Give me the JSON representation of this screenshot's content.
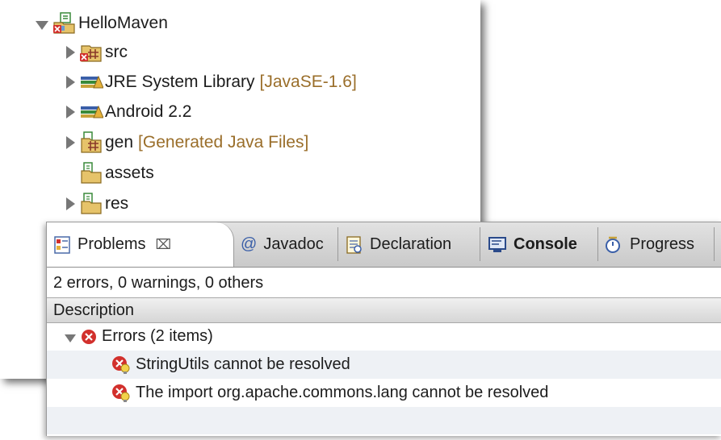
{
  "project_tree": {
    "root": {
      "label": "HelloMaven",
      "expanded": true,
      "icon": "maven-project-error-icon"
    },
    "items": [
      {
        "label": "src",
        "decoration": "",
        "expandable": true,
        "icon": "source-folder-error-icon"
      },
      {
        "label": "JRE System Library",
        "decoration": "[JavaSE-1.6]",
        "expandable": true,
        "icon": "library-icon"
      },
      {
        "label": "Android 2.2",
        "decoration": "",
        "expandable": true,
        "icon": "library-icon"
      },
      {
        "label": "gen",
        "decoration": "[Generated Java Files]",
        "expandable": true,
        "icon": "source-folder-icon"
      },
      {
        "label": "assets",
        "decoration": "",
        "expandable": false,
        "icon": "folder-icon"
      },
      {
        "label": "res",
        "decoration": "",
        "expandable": true,
        "icon": "folder-icon"
      }
    ]
  },
  "problems_view": {
    "tabs": [
      {
        "label": "Problems",
        "active": true,
        "close": "⌧",
        "icon": "problems-icon"
      },
      {
        "label": "Javadoc",
        "active": false,
        "icon": "at-icon",
        "icon_text": "@"
      },
      {
        "label": "Declaration",
        "active": false,
        "icon": "declaration-icon"
      },
      {
        "label": "Console",
        "active": false,
        "icon": "console-icon"
      },
      {
        "label": "Progress",
        "active": false,
        "icon": "progress-icon"
      }
    ],
    "summary": "2 errors, 0 warnings, 0 others",
    "column_header": "Description",
    "group": {
      "label": "Errors (2 items)",
      "expanded": true,
      "icon": "error-icon"
    },
    "errors": [
      {
        "label": "StringUtils cannot be resolved",
        "icon": "error-lightbulb-icon"
      },
      {
        "label": "The import org.apache.commons.lang cannot be resolved",
        "icon": "error-lightbulb-icon"
      }
    ]
  },
  "colors": {
    "decoration_text": "#9a6e2a",
    "error_red": "#d2302c",
    "tree_arrow": "#777777",
    "selection_blue": "#3a5fa8"
  }
}
